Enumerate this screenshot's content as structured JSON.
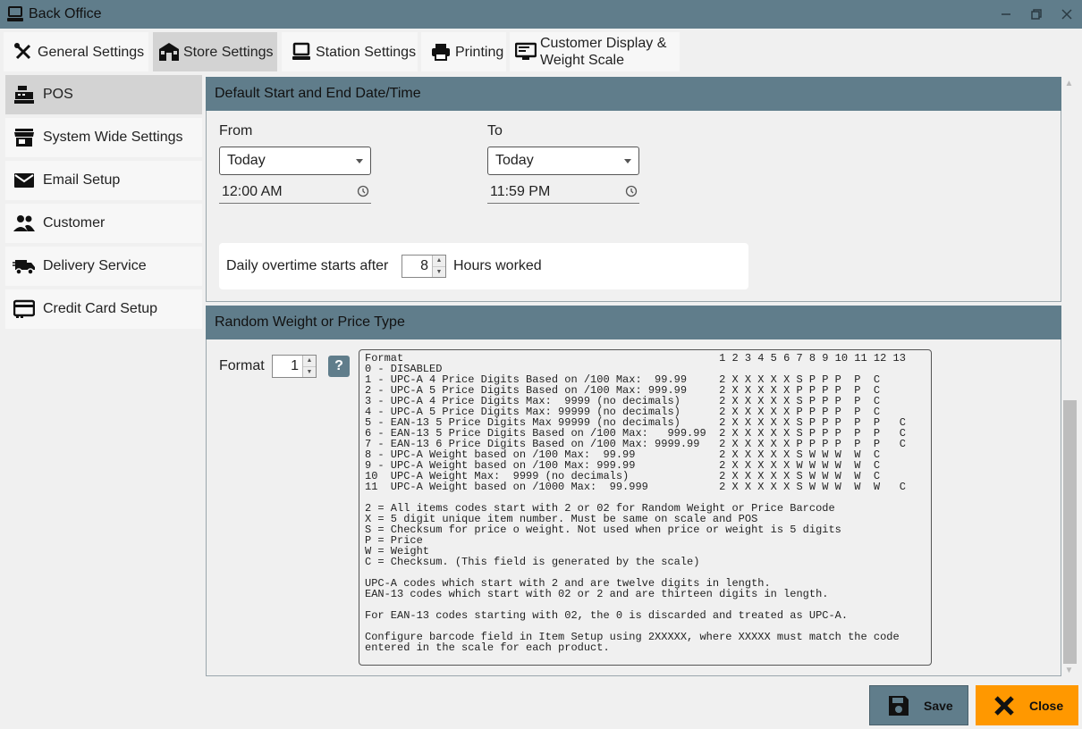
{
  "window": {
    "title": "Back Office",
    "icons": {
      "app": "computer-icon",
      "minimize": "minimize-icon",
      "restore": "restore-icon",
      "close": "close-icon"
    }
  },
  "tabs": [
    {
      "label": "General Settings",
      "icon": "tools-icon"
    },
    {
      "label": "Store Settings",
      "icon": "store-icon",
      "active": true
    },
    {
      "label": "Station Settings",
      "icon": "computer-icon"
    },
    {
      "label": "Printing",
      "icon": "printer-icon"
    },
    {
      "label": "Customer Display &\nWeight Scale",
      "icon": "display-icon"
    }
  ],
  "sidebar": {
    "items": [
      {
        "label": "POS",
        "icon": "cash-register-icon",
        "active": true
      },
      {
        "label": "System Wide Settings",
        "icon": "storefront-icon"
      },
      {
        "label": "Email Setup",
        "icon": "envelope-icon"
      },
      {
        "label": "Customer",
        "icon": "people-icon"
      },
      {
        "label": "Delivery Service",
        "icon": "truck-icon"
      },
      {
        "label": "Credit Card Setup",
        "icon": "credit-card-icon"
      }
    ]
  },
  "date_panel": {
    "title": "Default Start and End Date/Time",
    "from_label": "From",
    "to_label": "To",
    "from_date": "Today",
    "to_date": "Today",
    "from_time": "12:00 AM",
    "to_time": "11:59 PM",
    "overtime_label": "Daily overtime starts after",
    "overtime_value": "8",
    "overtime_suffix": "Hours worked"
  },
  "random_panel": {
    "title": "Random Weight or Price Type",
    "format_label": "Format",
    "format_value": "1",
    "help_label": "?",
    "format_text": "Format                                                 1 2 3 4 5 6 7 8 9 10 11 12 13\n0 - DISABLED\n1 - UPC-A 4 Price Digits Based on /100 Max:  99.99     2 X X X X X S P P P  P  C\n2 - UPC-A 5 Price Digits Based on /100 Max: 999.99     2 X X X X X P P P P  P  C\n3 - UPC-A 4 Price Digits Max:  9999 (no decimals)      2 X X X X X S P P P  P  C\n4 - UPC-A 5 Price Digits Max: 99999 (no decimals)      2 X X X X X P P P P  P  C\n5 - EAN-13 5 Price Digits Max 99999 (no decimals)      2 X X X X X S P P P  P  P   C\n6 - EAN-13 5 Price Digits Based on /100 Max:   999.99  2 X X X X X S P P P  P  P   C\n7 - EAN-13 6 Price Digits Based on /100 Max: 9999.99   2 X X X X X P P P P  P  P   C\n8 - UPC-A Weight based on /100 Max:  99.99             2 X X X X X S W W W  W  C\n9 - UPC-A Weight based on /100 Max: 999.99             2 X X X X X W W W W  W  C\n10  UPC-A Weight Max:  9999 (no decimals)              2 X X X X X S W W W  W  C\n11  UPC-A Weight based on /1000 Max:  99.999           2 X X X X X S W W W  W  W   C\n\n2 = All items codes start with 2 or 02 for Random Weight or Price Barcode\nX = 5 digit unique item number. Must be same on scale and POS\nS = Checksum for price o weight. Not used when price or weight is 5 digits\nP = Price\nW = Weight\nC = Checksum. (This field is generated by the scale)\n\nUPC-A codes which start with 2 and are twelve digits in length.\nEAN-13 codes which start with 02 or 2 and are thirteen digits in length.\n\nFor EAN-13 codes starting with 02, the 0 is discarded and treated as UPC-A.\n\nConfigure barcode field in Item Setup using 2XXXXX, where XXXXX must match the code\nentered in the scale for each product."
  },
  "footer": {
    "save_label": "Save",
    "close_label": "Close",
    "save_icon": "floppy-disk-icon",
    "close_icon": "x-mark-icon"
  }
}
